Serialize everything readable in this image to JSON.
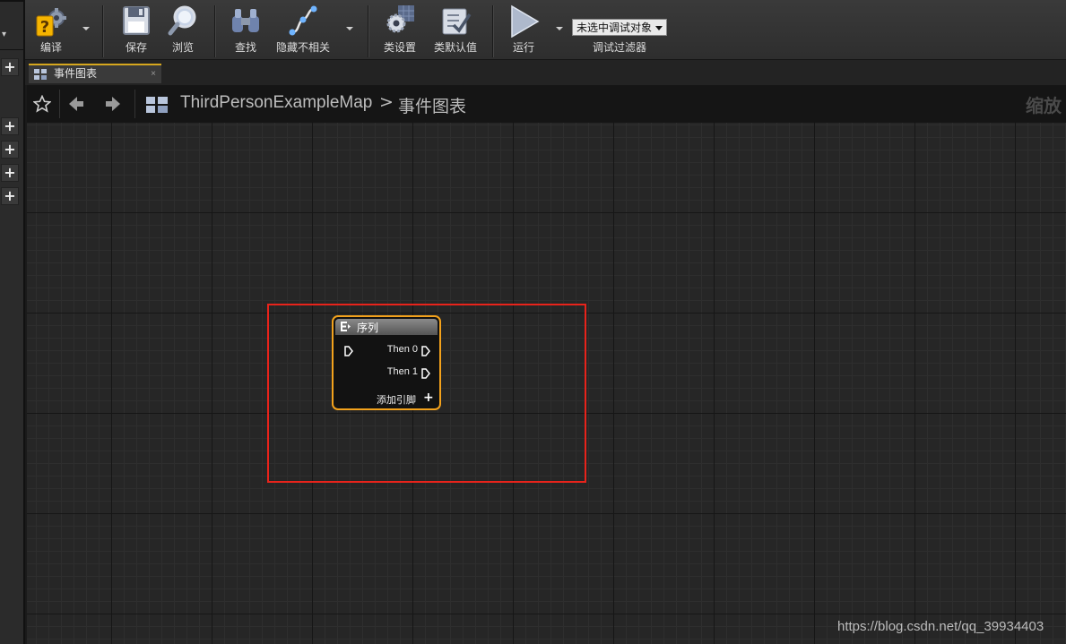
{
  "toolbar": {
    "compile_label": "编译",
    "save_label": "保存",
    "browse_label": "浏览",
    "find_label": "查找",
    "hide_unrelated_label": "隐藏不相关",
    "class_settings_label": "类设置",
    "class_defaults_label": "类默认值",
    "run_label": "运行",
    "debug_object_value": "未选中调试对象",
    "debug_filter_label": "调试过滤器"
  },
  "tab": {
    "label": "事件图表",
    "close_glyph": "×"
  },
  "breadcrumb": {
    "root": "ThirdPersonExampleMap",
    "separator": ">",
    "current": "事件图表",
    "zoom_label": "缩放"
  },
  "node": {
    "title": "序列",
    "outputs": [
      "Then 0",
      "Then 1"
    ],
    "add_pin_label": "添加引脚",
    "add_pin_glyph": "+"
  },
  "left_strip": {
    "collapse_glyph": "▾",
    "add_glyph": "+"
  },
  "watermark": "https://blog.csdn.net/qq_39934403",
  "colors": {
    "node_border": "#f3a21c",
    "highlight_box": "#e8231b",
    "tab_accent": "#d6a71e"
  }
}
